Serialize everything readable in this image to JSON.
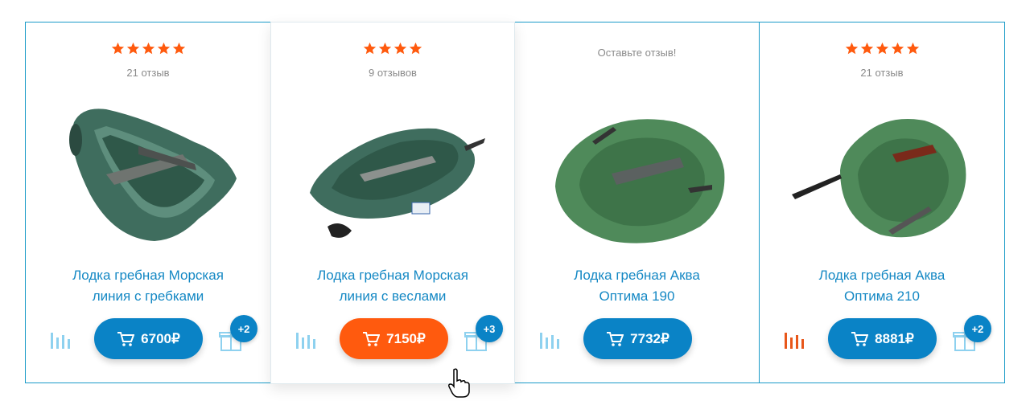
{
  "colors": {
    "accent": "#0a83c6",
    "price_active": "#ff5a0e",
    "star": "#ff5a0e",
    "border": "#1a9bc8"
  },
  "products": [
    {
      "name_line1": "Лодка гребная Морская",
      "name_line2": "линия с гребками",
      "stars": 5,
      "reviews": "21 отзыв",
      "price": "6700₽",
      "gift_count": "+2",
      "stats_active": false
    },
    {
      "name_line1": "Лодка гребная Морская",
      "name_line2": "линия с веслами",
      "stars": 4,
      "reviews": "9 отзывов",
      "price": "7150₽",
      "gift_count": "+3",
      "stats_active": false
    },
    {
      "name_line1": "Лодка гребная Аква",
      "name_line2": "Оптима 190",
      "stars": 0,
      "reviews": "Оставьте отзыв!",
      "price": "7732₽",
      "gift_count": "",
      "stats_active": false
    },
    {
      "name_line1": "Лодка гребная Аква",
      "name_line2": "Оптима 210",
      "stars": 5,
      "reviews": "21 отзыв",
      "price": "8881₽",
      "gift_count": "+2",
      "stats_active": true
    }
  ],
  "icons": {
    "rating": "star-icon",
    "cart": "cart-icon",
    "compare": "bar-chart-icon",
    "gift": "gift-icon",
    "cursor": "hand-pointer-icon"
  }
}
